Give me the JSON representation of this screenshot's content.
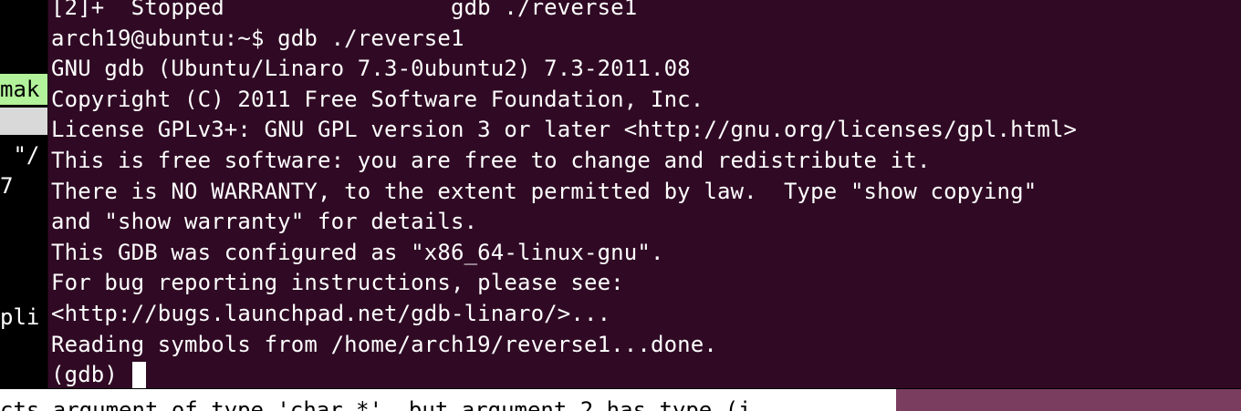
{
  "background_terminal": {
    "fragments": {
      "mak": "mak",
      "quote": " \"/",
      "seven": "7",
      "pli": "pli"
    },
    "bottom_line": "cts argument of type 'char *', but argument 2 has type (i"
  },
  "gdb_terminal": {
    "lines": [
      "[2]+  Stopped                 gdb ./reverse1",
      "arch19@ubuntu:~$ gdb ./reverse1",
      "GNU gdb (Ubuntu/Linaro 7.3-0ubuntu2) 7.3-2011.08",
      "Copyright (C) 2011 Free Software Foundation, Inc.",
      "License GPLv3+: GNU GPL version 3 or later <http://gnu.org/licenses/gpl.html>",
      "This is free software: you are free to change and redistribute it.",
      "There is NO WARRANTY, to the extent permitted by law.  Type \"show copying\"",
      "and \"show warranty\" for details.",
      "This GDB was configured as \"x86_64-linux-gnu\".",
      "For bug reporting instructions, please see:",
      "<http://bugs.launchpad.net/gdb-linaro/>...",
      "Reading symbols from /home/arch19/reverse1...done."
    ],
    "prompt": "(gdb) "
  },
  "colors": {
    "terminal_background": "#300a24",
    "terminal_text": "#ffffff",
    "status_green": "#b2f29a"
  }
}
